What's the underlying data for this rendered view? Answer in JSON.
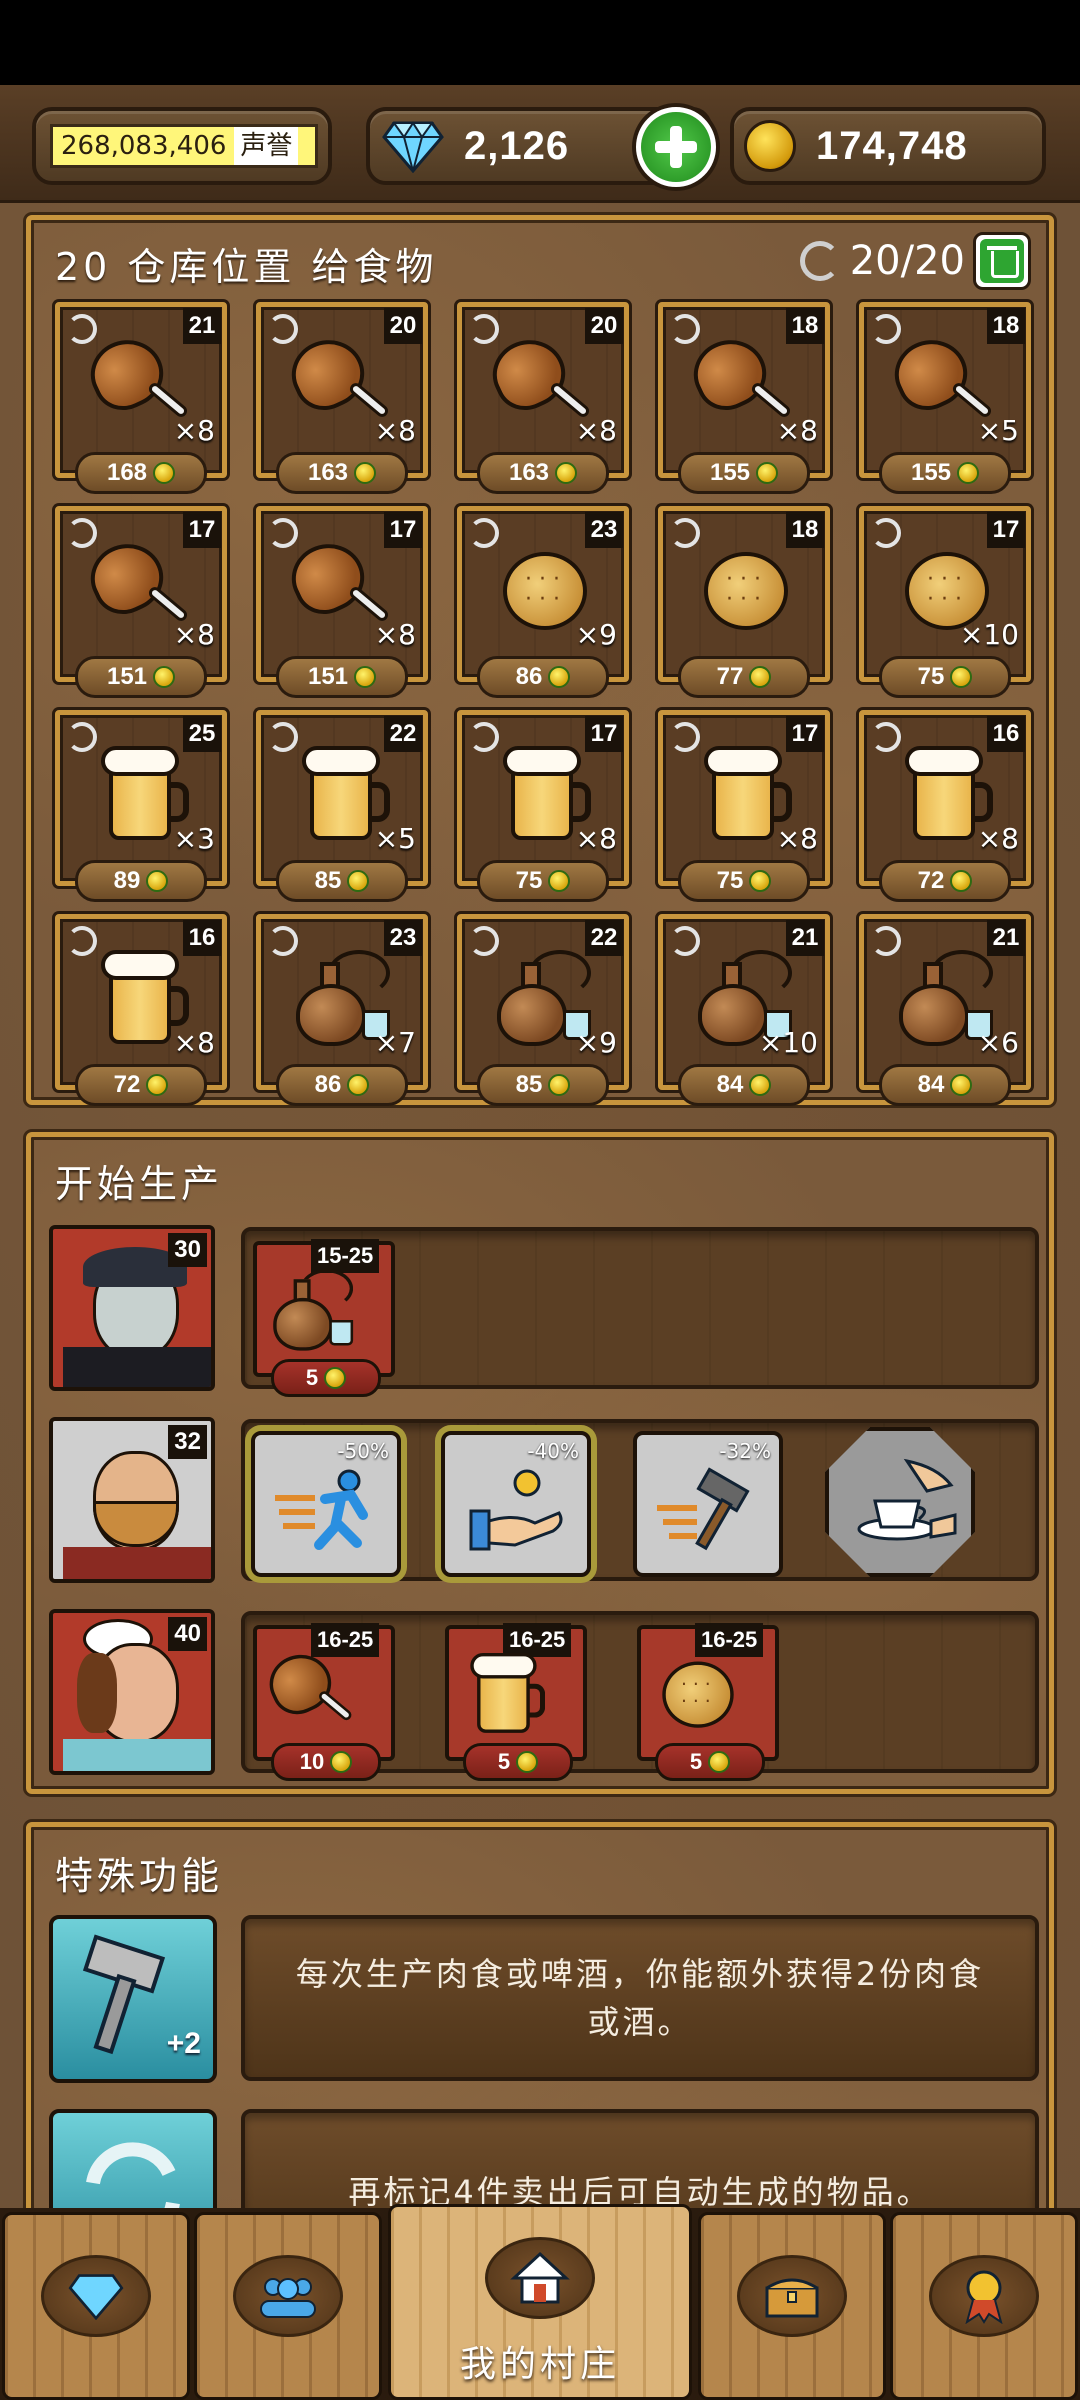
{
  "topbar": {
    "reputation_value": "268,083,406",
    "reputation_label": "声誉",
    "gems": "2,126",
    "gold": "174,748",
    "icons": [
      "diamond-icon",
      "plus-icon",
      "gold-coin-icon"
    ]
  },
  "storage": {
    "title": "20 仓库位置 给食物",
    "count": "20/20",
    "items": [
      {
        "type": "drumstick",
        "level": "21",
        "qty": "×8",
        "price": "168"
      },
      {
        "type": "drumstick",
        "level": "20",
        "qty": "×8",
        "price": "163"
      },
      {
        "type": "drumstick",
        "level": "20",
        "qty": "×8",
        "price": "163"
      },
      {
        "type": "drumstick",
        "level": "18",
        "qty": "×8",
        "price": "155"
      },
      {
        "type": "drumstick",
        "level": "18",
        "qty": "×5",
        "price": "155"
      },
      {
        "type": "drumstick",
        "level": "17",
        "qty": "×8",
        "price": "151"
      },
      {
        "type": "drumstick",
        "level": "17",
        "qty": "×8",
        "price": "151"
      },
      {
        "type": "cookie",
        "level": "23",
        "qty": "×9",
        "price": "86"
      },
      {
        "type": "cookie",
        "level": "18",
        "qty": "",
        "price": "77"
      },
      {
        "type": "cookie",
        "level": "17",
        "qty": "×10",
        "price": "75"
      },
      {
        "type": "beer",
        "level": "25",
        "qty": "×3",
        "price": "89"
      },
      {
        "type": "beer",
        "level": "22",
        "qty": "×5",
        "price": "85"
      },
      {
        "type": "beer",
        "level": "17",
        "qty": "×8",
        "price": "75"
      },
      {
        "type": "beer",
        "level": "17",
        "qty": "×8",
        "price": "75"
      },
      {
        "type": "beer",
        "level": "16",
        "qty": "×8",
        "price": "72"
      },
      {
        "type": "beer",
        "level": "16",
        "qty": "×8",
        "price": "72"
      },
      {
        "type": "flask",
        "level": "23",
        "qty": "×7",
        "price": "86"
      },
      {
        "type": "flask",
        "level": "22",
        "qty": "×9",
        "price": "85"
      },
      {
        "type": "flask",
        "level": "21",
        "qty": "×10",
        "price": "84"
      },
      {
        "type": "flask",
        "level": "21",
        "qty": "×6",
        "price": "84"
      }
    ]
  },
  "production": {
    "title": "开始生产",
    "workers": [
      {
        "name": "vampire",
        "level": "30",
        "jobs": [
          {
            "type": "flask",
            "range": "15-25",
            "cost": "5"
          }
        ]
      },
      {
        "name": "lumberjack",
        "level": "32",
        "skills": [
          {
            "name": "speed",
            "pct": "-50%"
          },
          {
            "name": "coin-hand",
            "pct": "-40%"
          },
          {
            "name": "hammer",
            "pct": "-32%"
          },
          {
            "name": "tea-service",
            "pct": ""
          }
        ]
      },
      {
        "name": "cook",
        "level": "40",
        "jobs": [
          {
            "type": "drumstick",
            "range": "16-25",
            "cost": "10"
          },
          {
            "type": "beer",
            "range": "16-25",
            "cost": "5"
          },
          {
            "type": "cookie",
            "range": "16-25",
            "cost": "5"
          }
        ]
      }
    ]
  },
  "special": {
    "title": "特殊功能",
    "items": [
      {
        "icon": "hammer-plus2-icon",
        "badge": "+2",
        "text": "每次生产肉食或啤酒，你能额外获得2份肉食或酒。"
      },
      {
        "icon": "refresh-icon",
        "text": "再标记4件卖出后可自动生成的物品。"
      }
    ]
  },
  "nav": {
    "items": [
      {
        "icon": "diamond-icon",
        "label": ""
      },
      {
        "icon": "people-icon",
        "label": ""
      },
      {
        "icon": "house-icon",
        "label": "我的村庄"
      },
      {
        "icon": "chest-icon",
        "label": ""
      },
      {
        "icon": "medal-icon",
        "label": ""
      }
    ]
  }
}
